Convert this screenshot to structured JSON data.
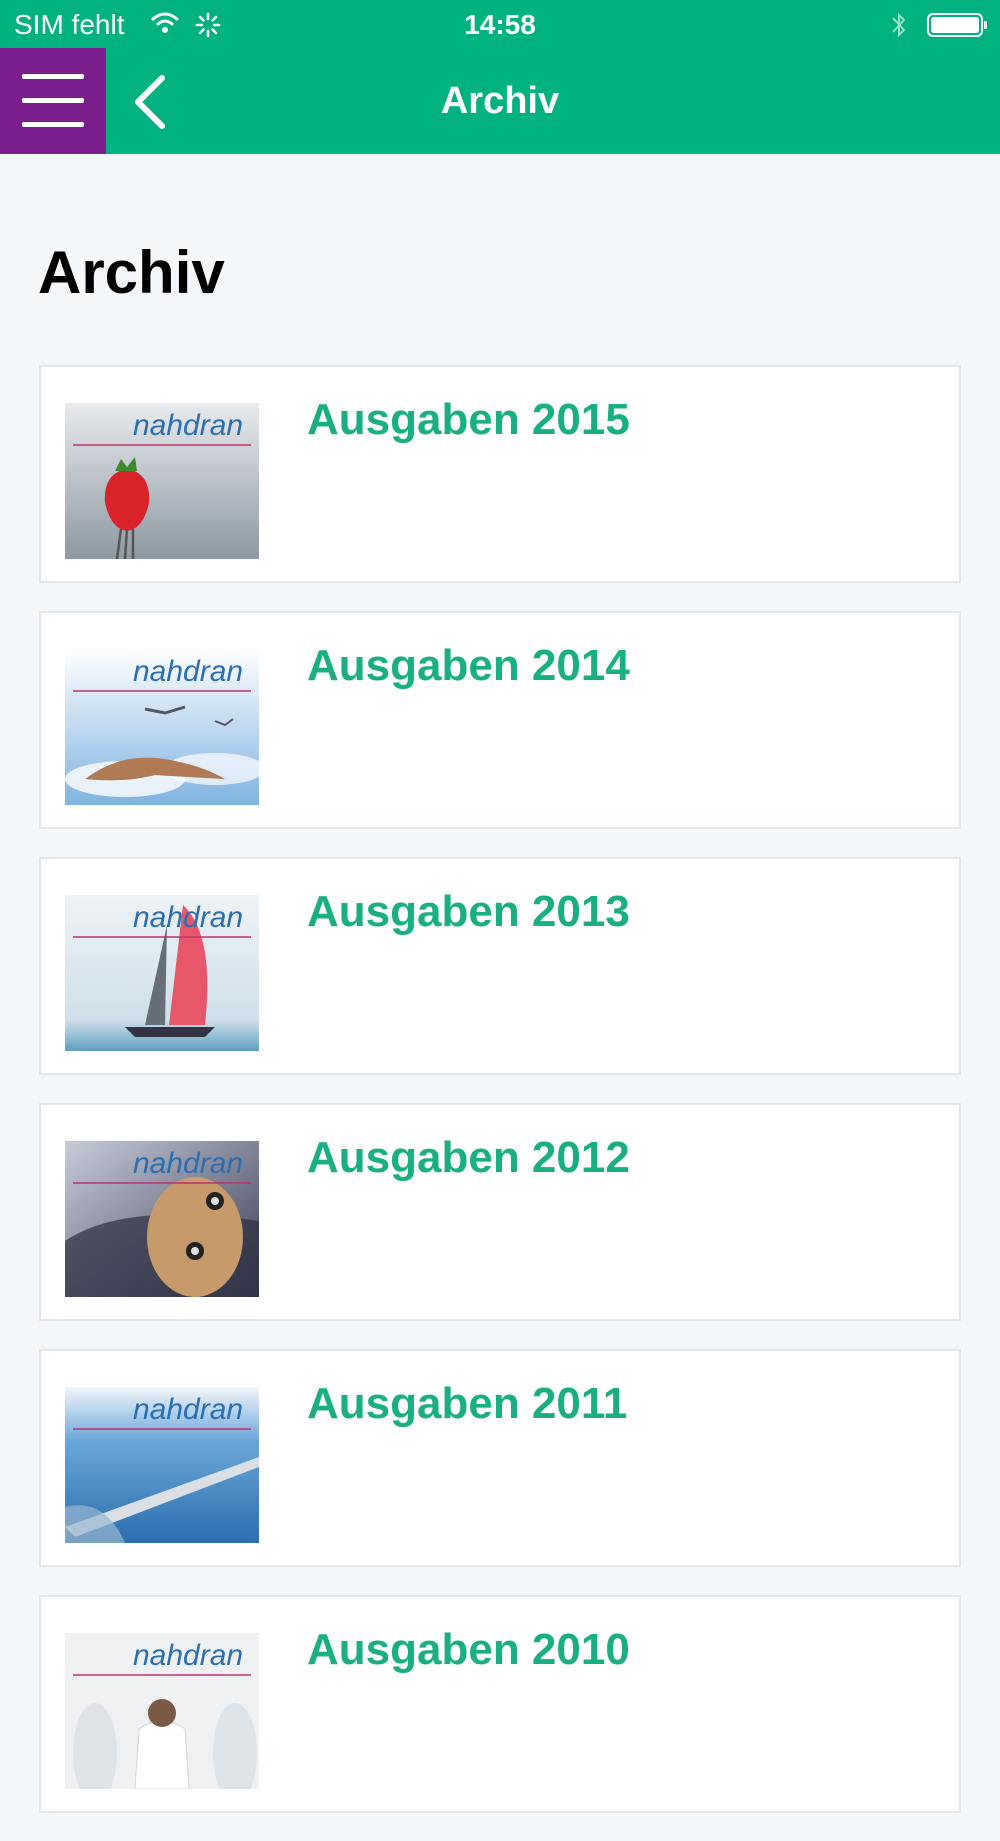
{
  "status_bar": {
    "carrier": "SIM fehlt",
    "time": "14:58"
  },
  "nav": {
    "title": "Archiv",
    "menu_icon": "hamburger-icon",
    "back_icon": "chevron-left-icon"
  },
  "page": {
    "title": "Archiv"
  },
  "items": [
    {
      "label": "Ausgaben 2015",
      "cover_brand": "nahdran",
      "cover_icon": "strawberry-cover"
    },
    {
      "label": "Ausgaben 2014",
      "cover_brand": "nahdran",
      "cover_icon": "birds-cover"
    },
    {
      "label": "Ausgaben 2013",
      "cover_brand": "nahdran",
      "cover_icon": "sailboat-cover"
    },
    {
      "label": "Ausgaben 2012",
      "cover_brand": "nahdran",
      "cover_icon": "crash-dummy-cover"
    },
    {
      "label": "Ausgaben 2011",
      "cover_brand": "nahdran",
      "cover_icon": "glass-roof-cover"
    },
    {
      "label": "Ausgaben 2010",
      "cover_brand": "nahdran",
      "cover_icon": "doctors-cover"
    }
  ],
  "colors": {
    "primary": "#00b27f",
    "menu": "#7b1f8f",
    "item_label": "#1aae83",
    "brand_text": "#2a6fb0",
    "brand_rule": "#c2306e"
  }
}
